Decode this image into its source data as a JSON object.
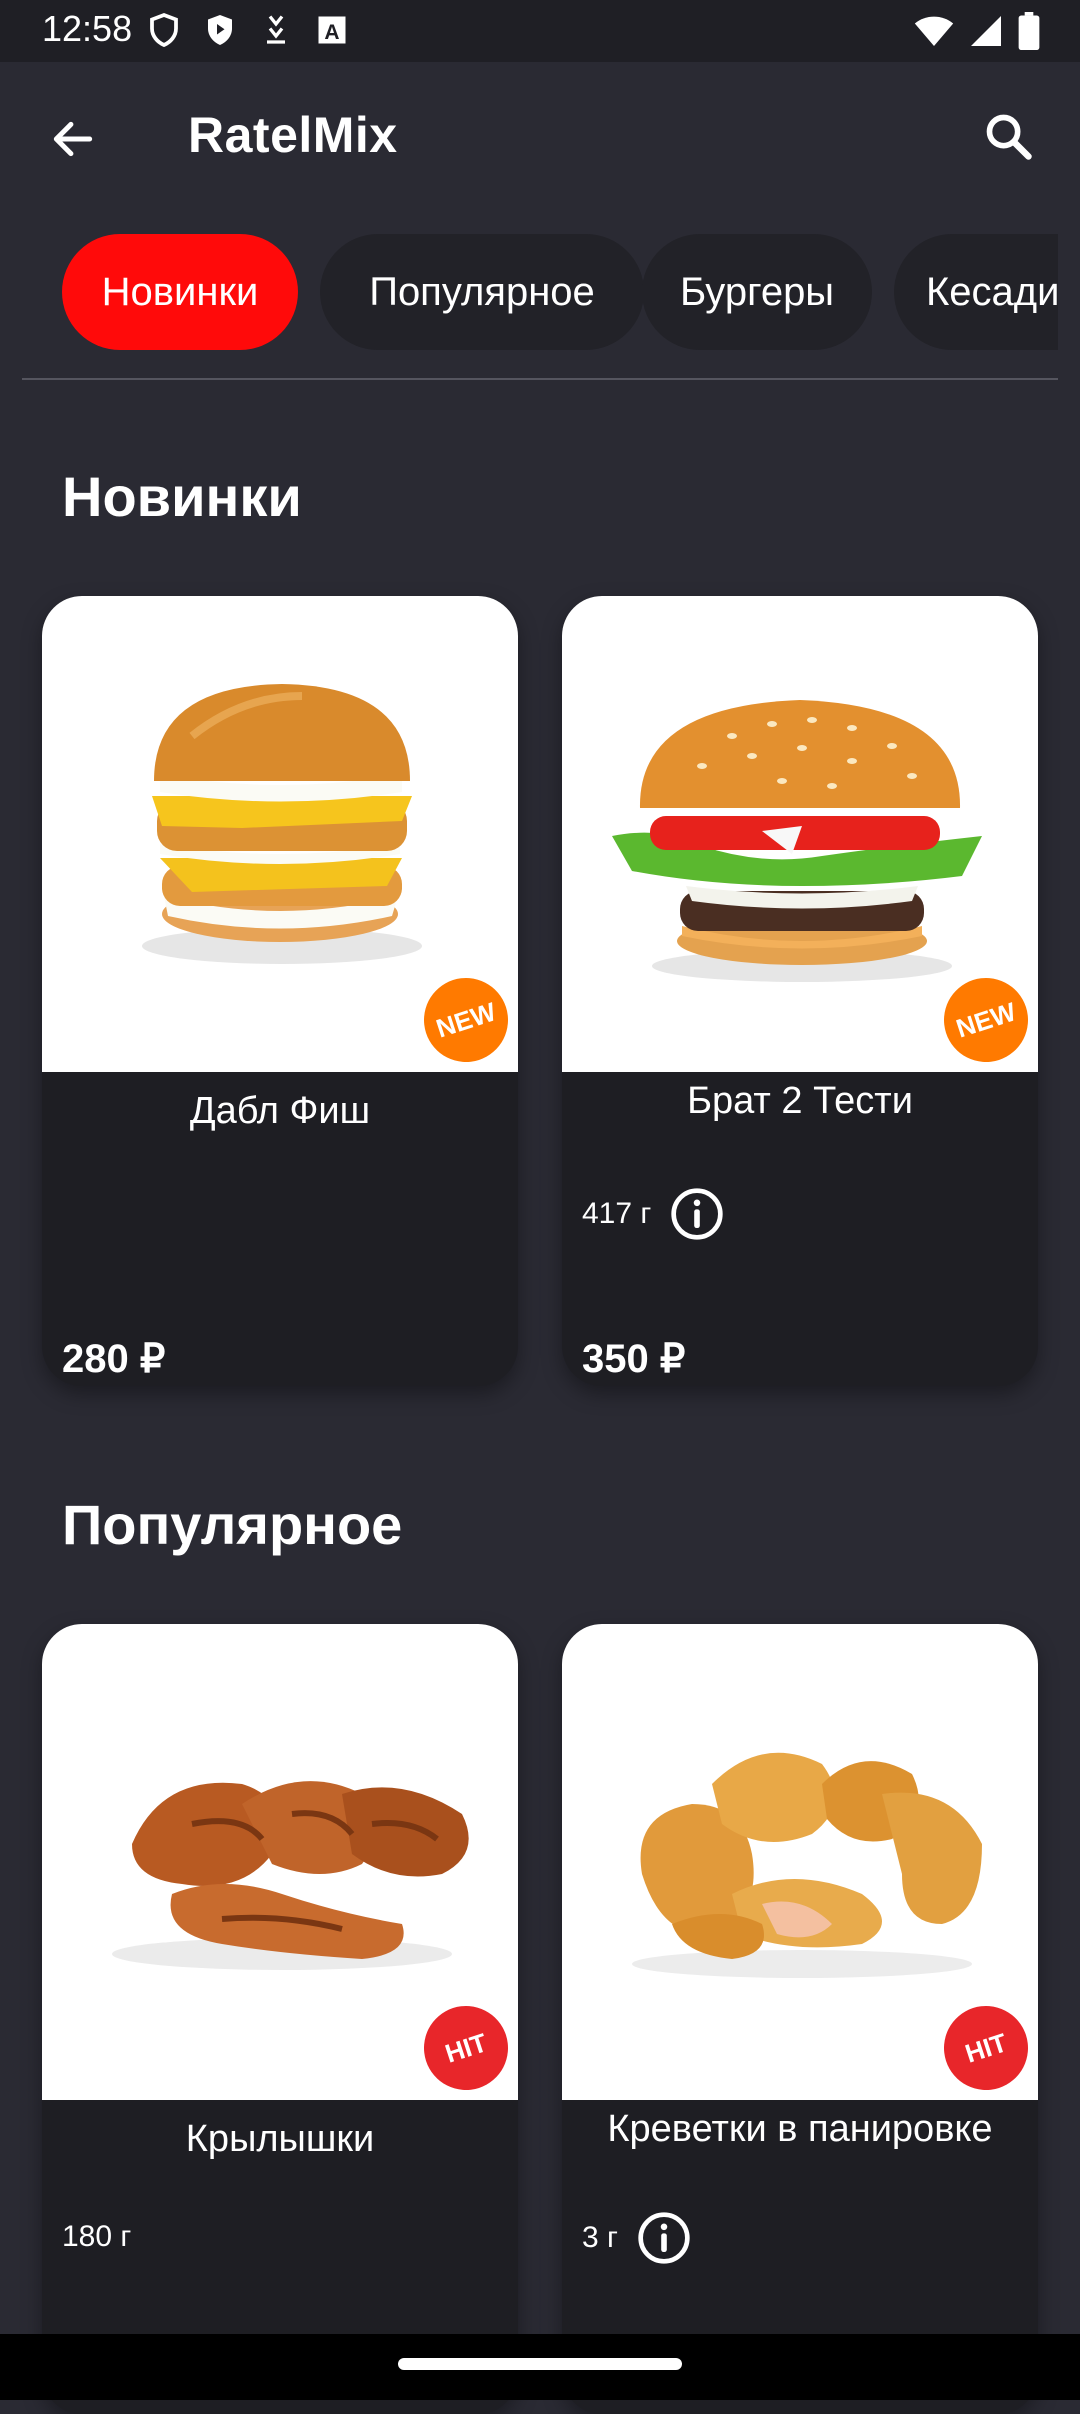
{
  "status_bar": {
    "time": "12:58"
  },
  "app_bar": {
    "title": "RatelMix"
  },
  "colors": {
    "accent": "#ff0a0a",
    "badge_new": "#ff7a00",
    "badge_hit": "#e8262a",
    "background": "#2a2a33",
    "card": "#1e1e23"
  },
  "tabs": [
    {
      "label": "Новинки",
      "active": true
    },
    {
      "label": "Популярное",
      "active": false
    },
    {
      "label": "Бургеры",
      "active": false
    },
    {
      "label": "Кесадильи",
      "active": false
    }
  ],
  "sections": [
    {
      "title": "Новинки",
      "items": [
        {
          "name": "Дабл Фиш",
          "weight": "",
          "price": "280 ₽",
          "badge": "NEW"
        },
        {
          "name": "Брат 2 Тести",
          "weight": "417 г",
          "price": "350 ₽",
          "badge": "NEW"
        }
      ]
    },
    {
      "title": "Популярное",
      "items": [
        {
          "name": "Крылышки",
          "weight": "180 г",
          "price": "",
          "badge": "HIT"
        },
        {
          "name": "Креветки в панировке",
          "weight": "3 г",
          "price": "",
          "badge": "HIT"
        }
      ]
    }
  ]
}
